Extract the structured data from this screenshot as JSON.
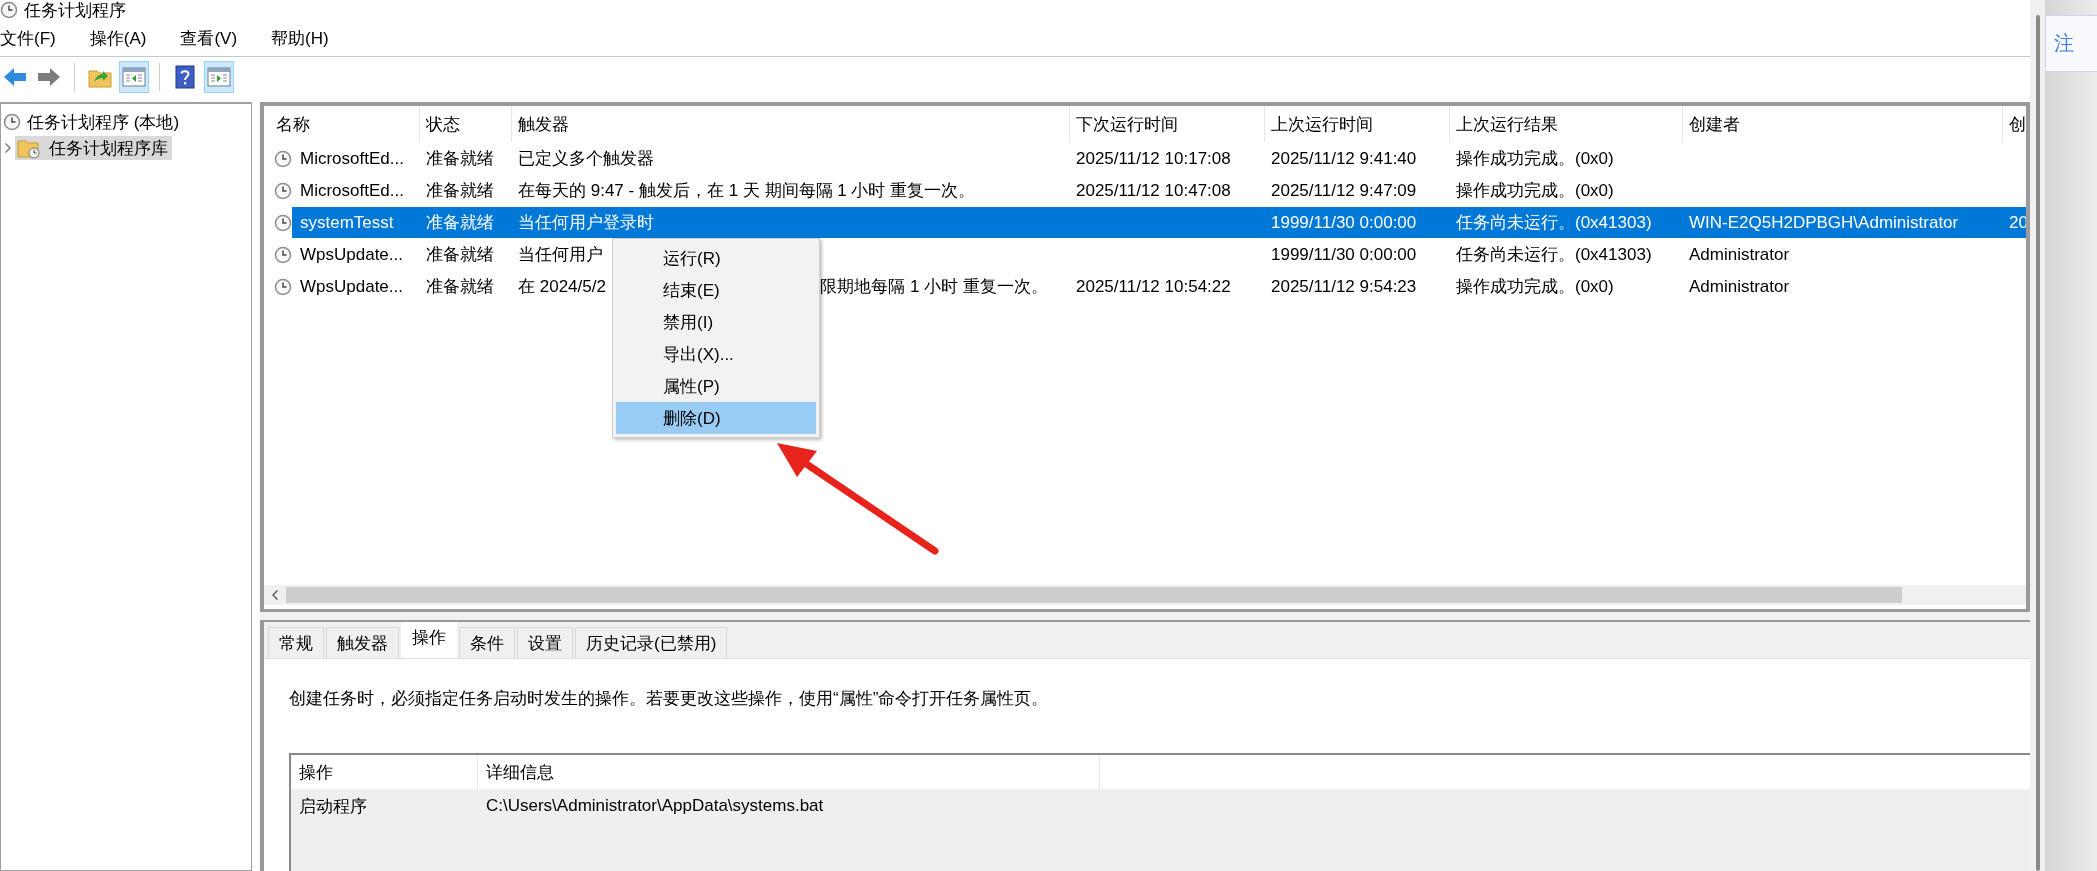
{
  "window": {
    "title": "任务计划程序"
  },
  "menu": [
    "文件(F)",
    "操作(A)",
    "查看(V)",
    "帮助(H)"
  ],
  "toolbar": [
    {
      "kind": "back",
      "pressed": false
    },
    {
      "kind": "forward",
      "pressed": false
    },
    {
      "kind": "up",
      "pressed": false
    },
    {
      "kind": "console_tree",
      "pressed": true
    },
    {
      "kind": "help",
      "pressed": false
    },
    {
      "kind": "action_pane",
      "pressed": true
    }
  ],
  "tree": [
    {
      "label": "任务计划程序 (本地)",
      "selected": false,
      "children": [
        {
          "label": "任务计划程序库",
          "selected": true,
          "expanded": false
        }
      ]
    }
  ],
  "tasks": {
    "columns": [
      "名称",
      "状态",
      "触发器",
      "下次运行时间",
      "上次运行时间",
      "上次运行结果",
      "创建者",
      "创"
    ],
    "rows": [
      {
        "selected": false,
        "name": "MicrosoftEd...",
        "status": "准备就绪",
        "trigger": "已定义多个触发器",
        "next_run": "2025/11/12 10:17:08",
        "last_run": "2025/11/12 9:41:40",
        "last_result": "操作成功完成。(0x0)"
      },
      {
        "selected": false,
        "name": "MicrosoftEd...",
        "status": "准备就绪",
        "trigger": "在每天的 9:47 - 触发后，在 1 天 期间每隔 1 小时 重复一次。",
        "next_run": "2025/11/12 10:47:08",
        "last_run": "2025/11/12 9:47:09",
        "last_result": "操作成功完成。(0x0)"
      },
      {
        "selected": true,
        "name": "systemTesst",
        "status": "准备就绪",
        "trigger": "当任何用户登录时",
        "last_run": "1999/11/30 0:00:00",
        "last_result": "任务尚未运行。(0x41303)",
        "author": "WIN-E2Q5H2DPBGH\\Administrator",
        "column_8": "20"
      },
      {
        "selected": false,
        "name": "WpsUpdate...",
        "status": "准备就绪",
        "trigger": "当任何用户",
        "last_run": "1999/11/30 0:00:00",
        "last_result": "任务尚未运行。(0x41303)",
        "author": "Administrator"
      },
      {
        "selected": false,
        "name": "WpsUpdate...",
        "status": "准备就绪",
        "trigger": "在 2024/5/2",
        "trigger_end": "限期地每隔 1 小时 重复一次。",
        "next_run": "2025/11/12 10:54:22",
        "last_run": "2025/11/12 9:54:23",
        "last_result": "操作成功完成。(0x0)",
        "author": "Administrator"
      }
    ]
  },
  "context_menu": {
    "items": [
      {
        "label": "运行(R)",
        "selected": false
      },
      {
        "label": "结束(E)",
        "selected": false
      },
      {
        "label": "禁用(I)",
        "selected": false
      },
      {
        "label": "导出(X)...",
        "selected": false
      },
      {
        "label": "属性(P)",
        "selected": false
      },
      {
        "label": "删除(D)",
        "selected": true
      }
    ]
  },
  "details": {
    "tabs": [
      {
        "label": "常规",
        "selected": false
      },
      {
        "label": "触发器",
        "selected": false
      },
      {
        "label": "操作",
        "selected": true
      },
      {
        "label": "条件",
        "selected": false
      },
      {
        "label": "设置",
        "selected": false
      },
      {
        "label": "历史记录(已禁用)",
        "selected": false
      }
    ],
    "description": "创建任务时，必须指定任务启动时发生的操作。若要更改这些操作，使用“属性”命令打开任务属性页。",
    "actions": {
      "columns": [
        "操作",
        "详细信息"
      ],
      "rows": [
        {
          "action": "启动程序",
          "details": "C:\\Users\\Administrator\\AppData\\systems.bat"
        }
      ]
    }
  },
  "side_panel": {
    "link": "注"
  }
}
